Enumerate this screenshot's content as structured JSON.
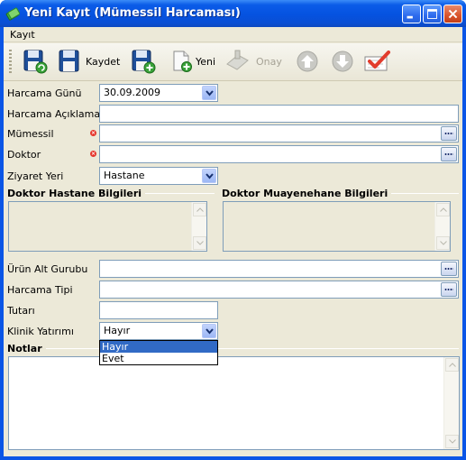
{
  "window": {
    "title": "Yeni Kayıt (Mümessil Harcaması)"
  },
  "menu": {
    "items": [
      "Kayıt"
    ]
  },
  "toolbar": {
    "save_label": "Kaydet",
    "new_label": "Yeni",
    "approve_label": "Onay"
  },
  "form": {
    "harcama_gunu": {
      "label": "Harcama Günü",
      "value": "30.09.2009"
    },
    "harcama_aciklamasi": {
      "label": "Harcama Açıklaması",
      "value": ""
    },
    "mumessil": {
      "label": "Mümessil",
      "value": "",
      "required": true
    },
    "doktor": {
      "label": "Doktor",
      "value": "",
      "required": true
    },
    "ziyaret_yeri": {
      "label": "Ziyaret Yeri",
      "value": "Hastane"
    },
    "urun_alt_gurubu": {
      "label": "Ürün Alt Gurubu",
      "value": ""
    },
    "harcama_tipi": {
      "label": "Harcama Tipi",
      "value": ""
    },
    "tutari": {
      "label": "Tutarı",
      "value": ""
    },
    "klinik_yatirimi": {
      "label": "Klinik Yatırımı",
      "value": "Hayır",
      "options": [
        "Hayır",
        "Evet"
      ]
    }
  },
  "groups": {
    "hospital_info": "Doktor Hastane Bilgileri",
    "practice_info": "Doktor Muayenehane Bilgileri",
    "notes": "Notlar"
  },
  "colors": {
    "titlebar": "#0a55e6",
    "client_bg": "#ece9d8",
    "input_border": "#7f9db9",
    "selection": "#316ac5",
    "required_marker": "#e5342a"
  }
}
